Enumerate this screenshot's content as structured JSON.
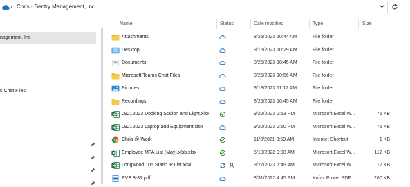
{
  "address": {
    "path": "Chris - Sentry Management, Inc",
    "separator": "›"
  },
  "nav": {
    "selected_label": "nagement, Inc",
    "teams_label": "s Chat Files"
  },
  "columns": {
    "name": "Name",
    "status": "Status",
    "date": "Date modified",
    "type": "Type",
    "size": "Size"
  },
  "files": [
    {
      "name": "Attachments",
      "icon": "folder-icon",
      "status": "cloud-icon",
      "date": "8/25/2023 10:44 AM",
      "type": "File folder",
      "size": ""
    },
    {
      "name": "Desktop",
      "icon": "desktop-folder-icon",
      "status": "cloud-icon",
      "date": "9/15/2023 10:29 AM",
      "type": "File folder",
      "size": ""
    },
    {
      "name": "Documents",
      "icon": "documents-folder-icon",
      "status": "cloud-icon",
      "date": "8/25/2023 10:45 AM",
      "type": "File folder",
      "size": ""
    },
    {
      "name": "Microsoft Teams Chat Files",
      "icon": "folder-icon",
      "status": "cloud-icon",
      "date": "8/25/2023 10:56 AM",
      "type": "File folder",
      "size": ""
    },
    {
      "name": "Pictures",
      "icon": "pictures-folder-icon",
      "status": "cloud-icon",
      "date": "9/18/2023 11:12 AM",
      "type": "File folder",
      "size": ""
    },
    {
      "name": "Recordings",
      "icon": "folder-icon",
      "status": "cloud-icon",
      "date": "8/25/2023 10:45 AM",
      "type": "File folder",
      "size": ""
    },
    {
      "name": "09212023 Docking Station and Light.xlsx",
      "icon": "excel-icon",
      "status": "check-icon",
      "date": "9/22/2023 2:53 PM",
      "type": "Microsoft Excel W...",
      "size": "75 KB"
    },
    {
      "name": "09212023 Laptop and Equipment.xlsx",
      "icon": "excel-icon",
      "status": "cloud-icon",
      "date": "9/22/2023 2:50 PM",
      "type": "Microsoft Excel W...",
      "size": "75 KB"
    },
    {
      "name": "Chris @ Work",
      "icon": "chrome-icon",
      "status": "check-icon",
      "date": "11/3/2021 8:59 AM",
      "type": "Internet Shortcut",
      "size": "1 KB"
    },
    {
      "name": "Employee MFA List (May).xlsb.xlsx",
      "icon": "excel-icon",
      "status": "check-icon",
      "date": "5/10/2022 9:08 AM",
      "type": "Microsoft Excel W...",
      "size": "112 KB"
    },
    {
      "name": "Longwood 105 Static IP List.xlsx",
      "icon": "excel-icon",
      "status": "sync-icon",
      "status2": "shared-person-icon",
      "date": "9/27/2023 7:49 AM",
      "type": "Microsoft Excel W...",
      "size": "17 KB"
    },
    {
      "name": "PVB 8-31.pdf",
      "icon": "pdf-icon",
      "status": "cloud-icon",
      "date": "8/31/2022 4:45 PM",
      "type": "Kofax Power PDF ...",
      "size": "260 KB"
    }
  ],
  "colors": {
    "folder": "#f5c342",
    "cloud": "#1f76c2",
    "check": "#107c10",
    "excel": "#1d6f42",
    "selection": "#e5e5e5"
  }
}
